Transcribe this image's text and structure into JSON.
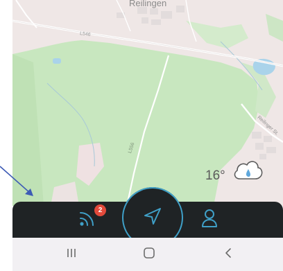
{
  "map": {
    "town_label": "Reilingen",
    "road_label_1": "L546",
    "road_label_2": "L556",
    "road_label_3": "Reilinger St."
  },
  "weather": {
    "temperature": "16°",
    "icon": "cloud-rain-icon"
  },
  "nav": {
    "feed_icon": "feed-icon",
    "feed_badge": "2",
    "navigate_icon": "navigation-arrow-icon",
    "profile_icon": "profile-icon"
  },
  "system_nav": {
    "recent_icon": "recent-apps-icon",
    "home_icon": "home-icon",
    "back_icon": "back-icon"
  },
  "colors": {
    "accent": "#3fa0c8",
    "nav_background": "#1f2325",
    "badge": "#e24a3b",
    "forest": "#c9e8c0",
    "annotation_arrow": "#3d5bb5"
  }
}
